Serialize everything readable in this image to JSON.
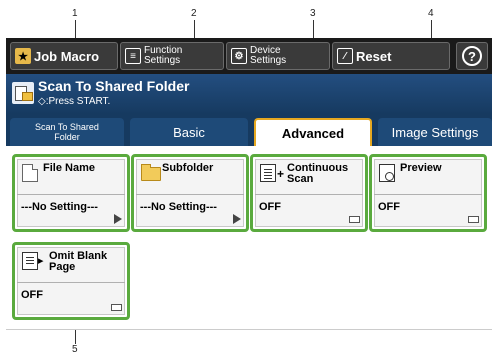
{
  "callouts": [
    "1",
    "2",
    "3",
    "4",
    "5"
  ],
  "toolbar": {
    "job_macro": "Job Macro",
    "function_settings": "Function\nSettings",
    "device_settings": "Device\nSettings",
    "reset": "Reset",
    "help": "?"
  },
  "header": {
    "title": "Scan To Shared Folder",
    "subtitle": "◇:Press START."
  },
  "tabs": [
    {
      "label": "Scan To Shared\nFolder",
      "active": false
    },
    {
      "label": "Basic",
      "active": false
    },
    {
      "label": "Advanced",
      "active": true
    },
    {
      "label": "Image Settings",
      "active": false
    }
  ],
  "cards": [
    {
      "label": "File Name",
      "value": "---No Setting---",
      "icon": "document-icon"
    },
    {
      "label": "Subfolder",
      "value": "---No Setting---",
      "icon": "folder-icon"
    },
    {
      "label": "Continuous\nScan",
      "value": "OFF",
      "icon": "continuous-scan-icon"
    },
    {
      "label": "Preview",
      "value": "OFF",
      "icon": "preview-icon"
    },
    {
      "label": "Omit Blank\nPage",
      "value": "OFF",
      "icon": "omit-blank-page-icon"
    }
  ],
  "colors": {
    "card_border": "#5aaa3e",
    "active_tab_border": "#e6a821",
    "title_bar": "#234e80"
  }
}
